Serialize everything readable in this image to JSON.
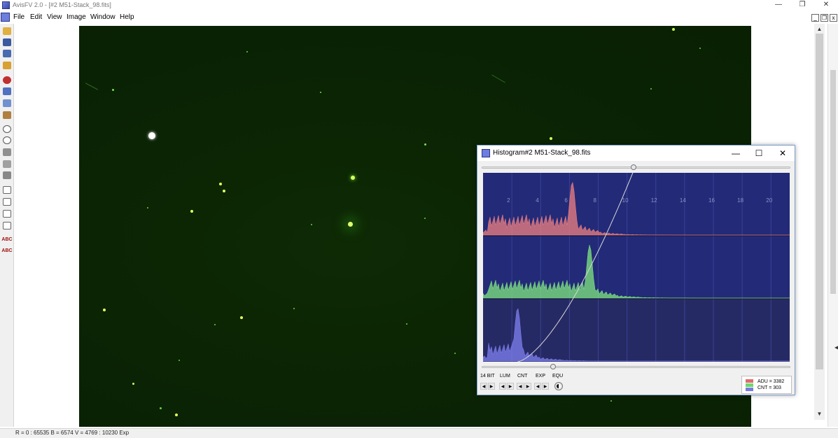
{
  "app": {
    "title": "AvisFV 2.0 - [#2 M51-Stack_98.fits]",
    "window_controls": {
      "minimize": "—",
      "restore": "❐",
      "close": "✕"
    }
  },
  "menu": {
    "items": [
      "File",
      "Edit",
      "View",
      "Image",
      "Window",
      "Help"
    ],
    "mdi_controls": {
      "minimize": "_",
      "restore": "❐",
      "close": "x"
    }
  },
  "toolbar": {
    "icons": [
      "open-folder-icon",
      "save-icon",
      "save-as-icon",
      "folder-icon",
      "refresh-icon",
      "stack-icon",
      "copy-icon",
      "paste-icon",
      "zoom-in-icon",
      "zoom-out-icon",
      "monitor-icon",
      "settings-icon",
      "calculator-icon",
      "search-icon",
      "chart-icon",
      "grid-icon",
      "sigma-icon"
    ],
    "text_buttons": [
      "ABC",
      "ABC"
    ]
  },
  "status": {
    "text": "R = 0 : 65535   B = 6574   V = 4769 : 10230 Exp"
  },
  "histogram": {
    "title": "Histogram#2 M51-Stack_98.fits",
    "window_controls": {
      "minimize": "—",
      "maximize": "☐",
      "close": "✕"
    },
    "top_slider": 0.49,
    "bottom_slider": 0.23,
    "controls": [
      "14 BIT",
      "LUM",
      "CNT",
      "EXP",
      "EQU"
    ],
    "legend": {
      "adu": "ADU = 3382",
      "cnt": "CNT = 303",
      "colors": [
        "#e06c6c",
        "#6cd86c",
        "#7a7ae0"
      ]
    }
  },
  "chart_data": {
    "type": "area",
    "x_ticks": [
      "2",
      "4",
      "6",
      "8",
      "10",
      "12",
      "14",
      "16",
      "18",
      "20"
    ],
    "xlim": [
      0,
      21.3
    ],
    "grid": true,
    "series": [
      {
        "color": "#f08080",
        "peak_x": 6.2,
        "peak": 1.0,
        "floor": 0.4
      },
      {
        "color": "#80e880",
        "peak_x": 7.4,
        "peak": 1.0,
        "floor": 0.35
      },
      {
        "color": "#8080f0",
        "peak_x": 2.4,
        "peak": 1.0,
        "floor": 0.35
      }
    ],
    "curve": {
      "color": "#d8d8d8"
    }
  }
}
